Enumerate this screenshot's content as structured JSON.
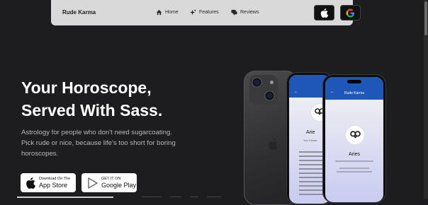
{
  "nav": {
    "brand": "Rude Karma",
    "links": [
      {
        "label": "Home",
        "icon": "home-icon"
      },
      {
        "label": "Features",
        "icon": "sparkle-icon"
      },
      {
        "label": "Reviews",
        "icon": "chat-icon"
      }
    ]
  },
  "hero": {
    "title_line1": "Your Horoscope,",
    "title_line2": "Served With Sass.",
    "subtitle_line1": "Astrology for people who don't need sugarcoating.",
    "subtitle_line2": "Pick rude or nice, because life's too short for boring",
    "subtitle_line3": "horoscopes."
  },
  "badges": {
    "app_store": {
      "small": "Download On The",
      "big": "App Store"
    },
    "google_play": {
      "small": "GET IT ON",
      "big": "Google Play"
    }
  },
  "phone_screens": {
    "app_title": "Rude Karma",
    "sign": "Aries",
    "partial_sign": "Arie",
    "partial_sub": "You Chose"
  },
  "colors": {
    "background": "#1d1d1f",
    "nav_bg": "#d9d9d9",
    "screen_header": "#1e57b8",
    "subtitle": "#b8b8b8"
  }
}
